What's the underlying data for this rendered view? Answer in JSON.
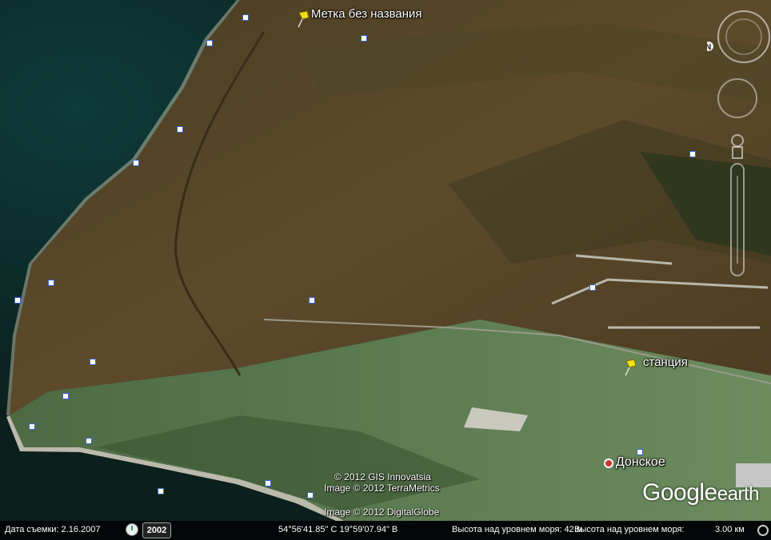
{
  "map": {
    "placemarks": [
      {
        "label": "Метка без названия",
        "icon": "yellow-pushpin-icon"
      },
      {
        "label": "станция",
        "icon": "yellow-pushpin-icon"
      }
    ],
    "places": [
      {
        "label": "Донское",
        "icon": "town-dot-icon"
      }
    ]
  },
  "credits": {
    "line1": "© 2012 GIS Innovatsia",
    "line2": "Image © 2012 TerraMetrics",
    "line3": "Image © 2012 DigitalGlobe"
  },
  "logo": {
    "main": "Google",
    "suffix": "earth"
  },
  "status": {
    "imagery_date": "Дата съемки: 2.16.2007",
    "year": "2002",
    "coordinates": "54°56'41.85\" С  19°59'07.94\" В",
    "elevation": "Высота над уровнем моря:  42 м",
    "eye_alt": "Высота над уровнем моря:",
    "scale": "3.00 км"
  },
  "nav_controls": {
    "north": "N",
    "icons": [
      "compass-ring-icon",
      "look-joystick-icon",
      "pegman-icon",
      "zoom-slider-icon"
    ]
  },
  "colors": {
    "sea": "#10302c",
    "land_brown": "#5a4a2c",
    "land_green": "#5b7a4f",
    "pin": "#f2e11a"
  }
}
